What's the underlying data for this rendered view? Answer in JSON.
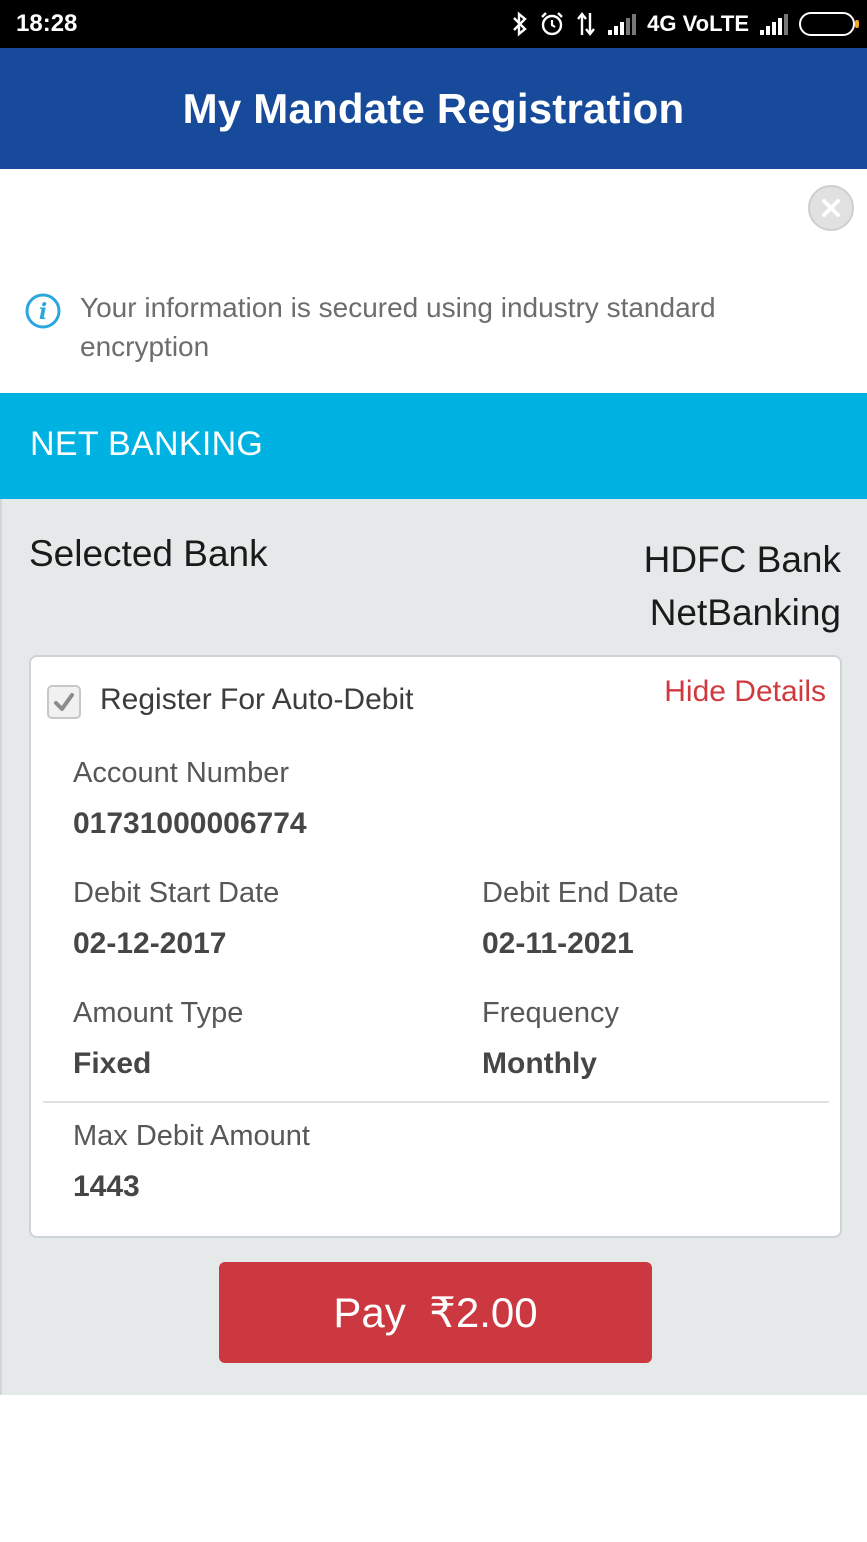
{
  "status_bar": {
    "time": "18:28",
    "network": "4G VoLTE"
  },
  "header": {
    "title": "My Mandate Registration"
  },
  "info": {
    "text": "Your information is secured using industry standard encryption"
  },
  "section": {
    "title": "NET BANKING"
  },
  "bank": {
    "label": "Selected Bank",
    "name": "HDFC Bank NetBanking"
  },
  "mandate": {
    "register_label": "Register For Auto-Debit",
    "registered": true,
    "hide_details_label": "Hide Details",
    "account_number_label": "Account Number",
    "account_number": "01731000006774",
    "debit_start_label": "Debit Start Date",
    "debit_start": "02-12-2017",
    "debit_end_label": "Debit End Date",
    "debit_end": "02-11-2021",
    "amount_type_label": "Amount Type",
    "amount_type": "Fixed",
    "frequency_label": "Frequency",
    "frequency": "Monthly",
    "max_debit_label": "Max Debit Amount",
    "max_debit": "1443"
  },
  "pay_button": {
    "label": "Pay",
    "amount": "₹2.00"
  },
  "colors": {
    "header_bg": "#174a9a",
    "section_bg": "#00b2e2",
    "pay_button_bg": "#cc3840",
    "link": "#d03a3f"
  }
}
